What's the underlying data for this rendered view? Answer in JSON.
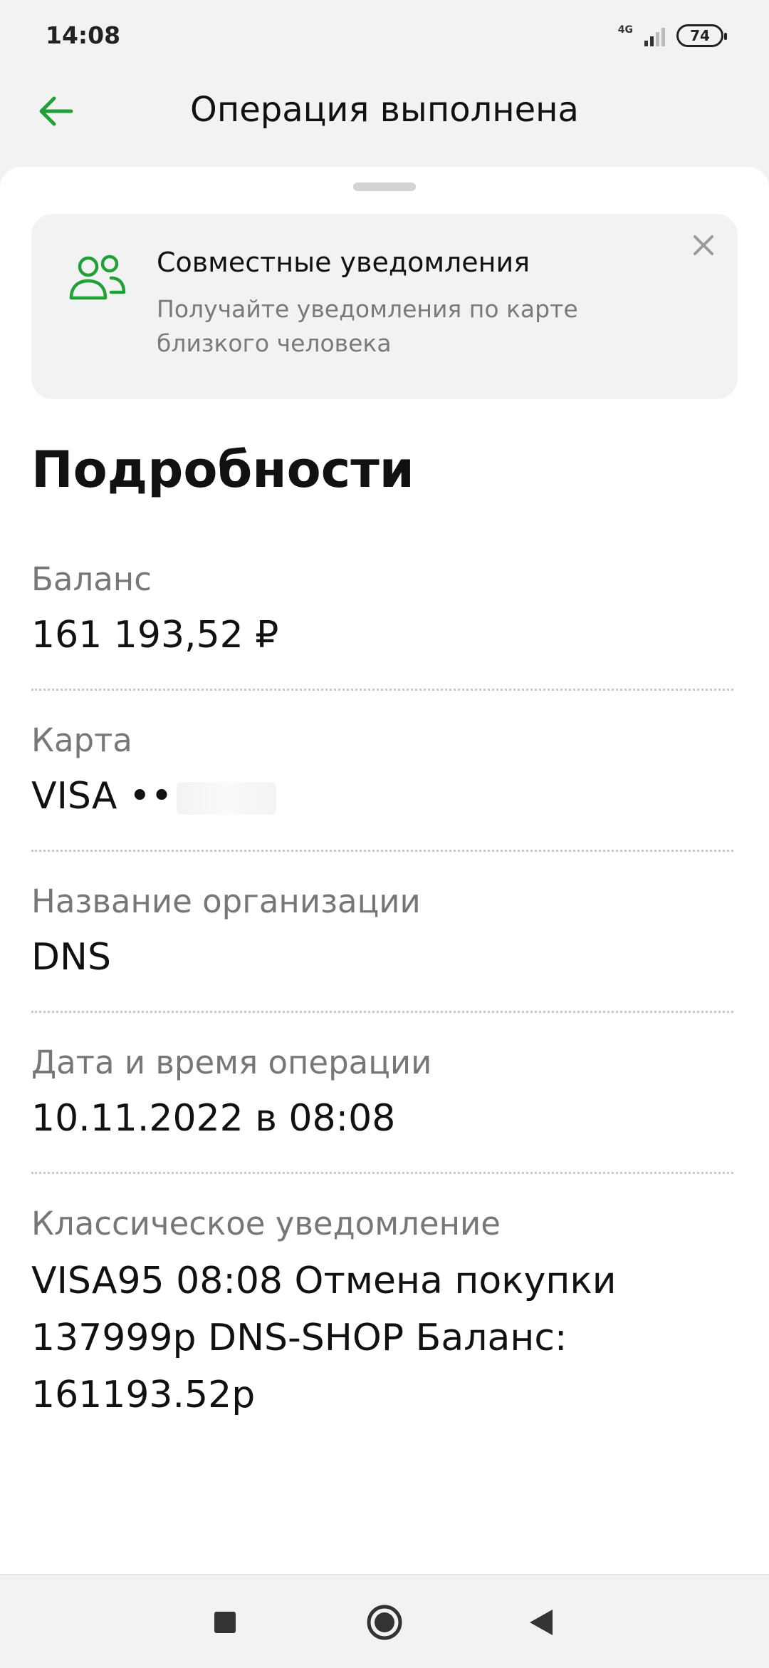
{
  "status_bar": {
    "time": "14:08",
    "network": "4G",
    "battery": "74"
  },
  "header": {
    "title": "Операция выполнена"
  },
  "promo": {
    "title": "Совместные уведомления",
    "text": "Получайте уведомления по карте близкого человека"
  },
  "details": {
    "section_title": "Подробности",
    "items": [
      {
        "label": "Баланс",
        "value": "161 193,52 ₽"
      },
      {
        "label": "Карта",
        "value": "VISA ••"
      },
      {
        "label": "Название организации",
        "value": "DNS"
      },
      {
        "label": "Дата и время операции",
        "value": "10.11.2022 в 08:08"
      },
      {
        "label": "Классическое уведомление",
        "value": "VISA95 08:08 Отмена покупки 137999р DNS-SHOP Баланс: 161193.52р"
      }
    ]
  },
  "colors": {
    "accent": "#21a038",
    "label_gray": "#777777",
    "sheet_bg": "#ffffff",
    "page_bg": "#f2f2f2"
  },
  "icons": {
    "back": "arrow-left-icon",
    "promo": "people-icon",
    "close": "close-icon",
    "nav_recents": "square-icon",
    "nav_home": "circle-icon",
    "nav_back": "triangle-back-icon"
  }
}
